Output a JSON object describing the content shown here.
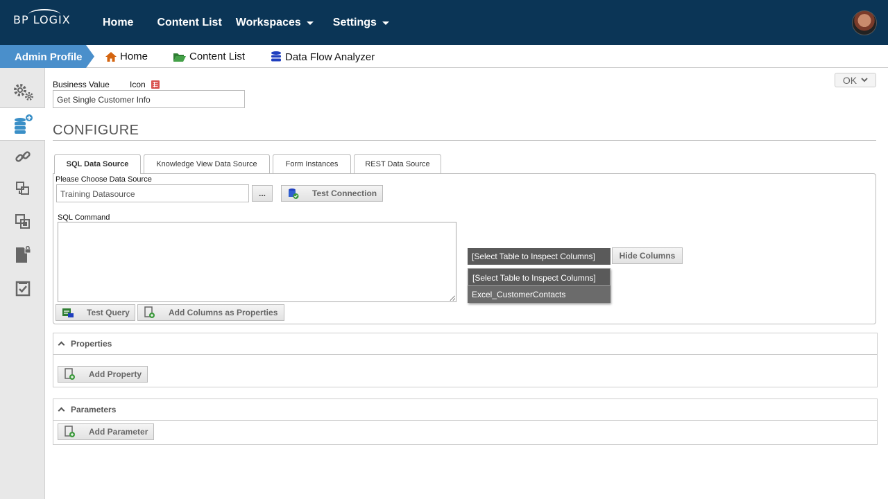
{
  "topbar": {
    "logo_text": "BP LOGIX",
    "nav": [
      {
        "label": "Home",
        "has_caret": false
      },
      {
        "label": "Content List",
        "has_caret": false
      },
      {
        "label": "Workspaces",
        "has_caret": true
      },
      {
        "label": "Settings",
        "has_caret": true
      }
    ]
  },
  "subbar": {
    "profile_label": "Admin Profile",
    "breadcrumbs": [
      {
        "label": "Home",
        "icon": "home-icon"
      },
      {
        "label": "Content List",
        "icon": "folder-open-icon"
      },
      {
        "label": "Data Flow Analyzer",
        "icon": "database-icon"
      }
    ]
  },
  "sidebar": {
    "items": [
      {
        "icon": "settings-gears-icon",
        "active": false
      },
      {
        "icon": "database-add-icon",
        "active": true
      },
      {
        "icon": "link-icon",
        "active": false
      },
      {
        "icon": "move-icon",
        "active": false
      },
      {
        "icon": "copy-icon",
        "active": false
      },
      {
        "icon": "locked-document-icon",
        "active": false
      },
      {
        "icon": "checklist-icon",
        "active": false
      }
    ]
  },
  "header": {
    "business_value_label": "Business Value",
    "icon_label": "Icon",
    "business_value": "Get Single Customer Info",
    "ok_label": "OK"
  },
  "configure": {
    "title": "CONFIGURE",
    "tabs": [
      {
        "label": "SQL Data Source",
        "active": true
      },
      {
        "label": "Knowledge View Data Source",
        "active": false
      },
      {
        "label": "Form Instances",
        "active": false
      },
      {
        "label": "REST Data Source",
        "active": false
      }
    ],
    "data_source_label": "Please Choose Data Source",
    "data_source_value": "Training Datasource",
    "browse_label": "...",
    "test_connection_label": "Test Connection",
    "sql_command_label": "SQL Command",
    "sql_command_value": "",
    "table_select_value": "[Select Table to Inspect Columns]",
    "table_options": [
      "[Select Table to Inspect Columns]",
      "Excel_CustomerContacts"
    ],
    "hide_columns_label": "Hide Columns",
    "test_query_label": "Test Query",
    "add_columns_label": "Add Columns as Properties"
  },
  "properties": {
    "title": "Properties",
    "add_label": "Add Property"
  },
  "parameters": {
    "title": "Parameters",
    "add_label": "Add Parameter"
  },
  "colors": {
    "topbar": "#0b3556",
    "profile_tab": "#4a8fcb",
    "sidebar": "#e8e8e8",
    "dropdown": "#6b6b6b"
  }
}
